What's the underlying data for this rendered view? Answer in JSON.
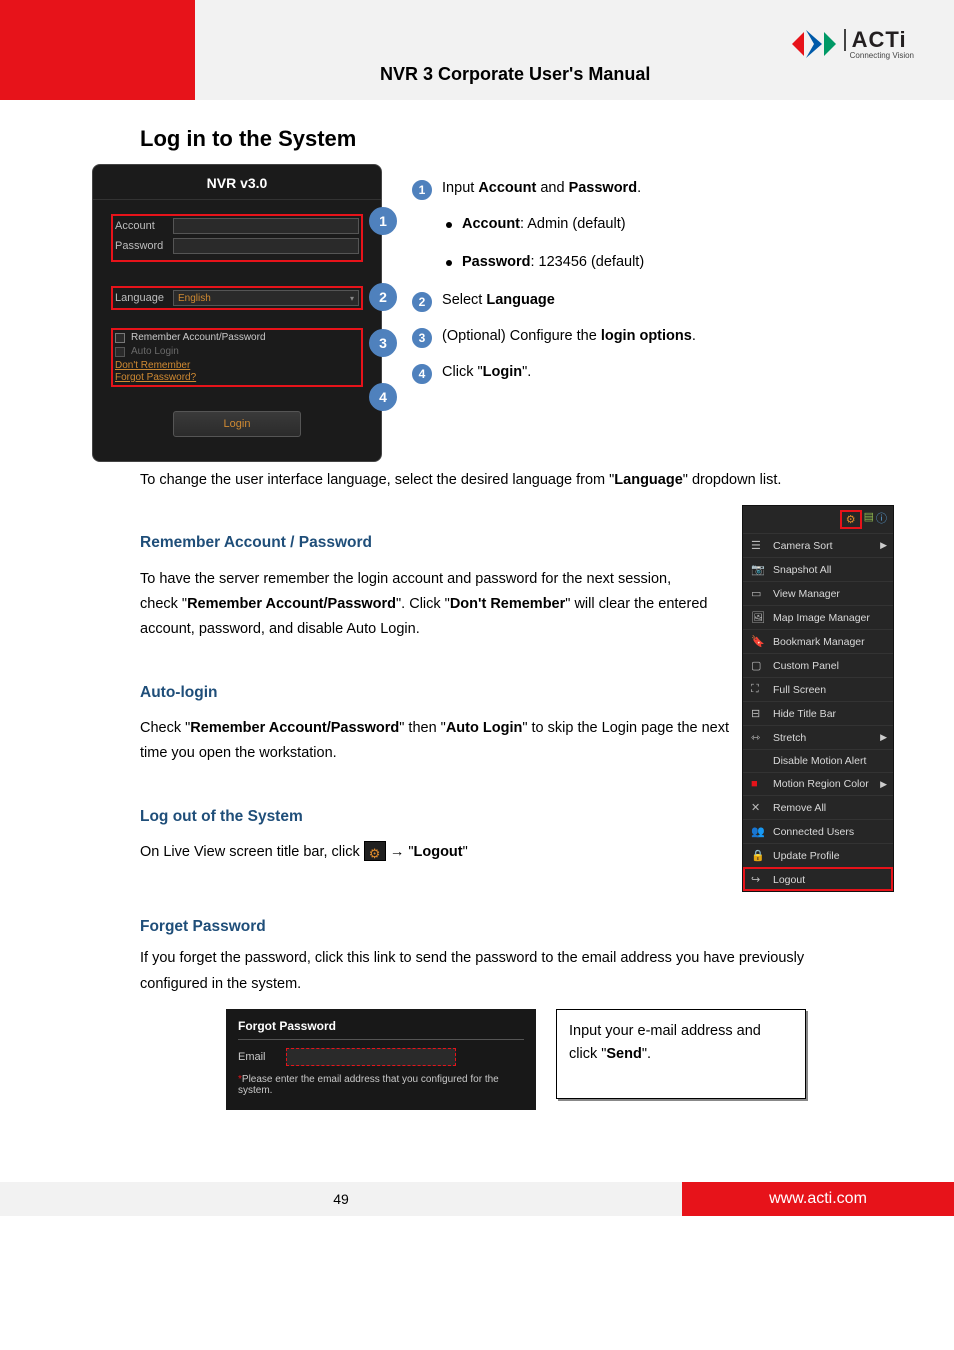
{
  "header": {
    "title": "NVR 3 Corporate User's Manual",
    "brand": "ACTi",
    "tagline": "Connecting Vision"
  },
  "section": {
    "title": "Log in to the System"
  },
  "login": {
    "title": "NVR v3.0",
    "account": "Account",
    "password": "Password",
    "language": "Language",
    "language_value": "English",
    "remember": "Remember Account/Password",
    "auto": "Auto Login",
    "dont": "Don't Remember",
    "forgot": "Forgot Password?",
    "button": "Login"
  },
  "circles": {
    "c1": "1",
    "c2": "2",
    "c3": "3",
    "c4": "4"
  },
  "steps": {
    "s1": {
      "n": "1",
      "text_a": "Input ",
      "text_b": "Account",
      "text_c": " and ",
      "text_d": "Password",
      "text_e": "."
    },
    "bullet1a": " Account",
    "bullet1b": ": Admin (default)",
    "bullet2a": " Password",
    "bullet2b": ": 123456 (default)",
    "s2_a": "Select ",
    "s2_b": "Language",
    "s2_n": "2",
    "s3_a": "(Optional) Configure the ",
    "s3_b": "login options",
    "s3_c": ".",
    "s3_n": "3",
    "s4_a": "Click \"",
    "s4_b": "Login",
    "s4_c": "\".",
    "s4_n": "4"
  },
  "lang_para": {
    "a": "To change the user interface language, select the desired language from \"",
    "b": "Language",
    "c": "\" dropdown list."
  },
  "rem": {
    "title": "Remember Account / Password",
    "a": "To have the server remember the login account and password for the next session,",
    "b": "check \"",
    "c": "Remember Account/Password",
    "d": "\". Click \"",
    "e": "Don't Remember",
    "f": "\" will clear the entered account, password, and disable Auto Login."
  },
  "auto": {
    "title": "Auto-login",
    "a": "Check \"",
    "b": "Remember Account/Password",
    "c": "\" then \"",
    "d": "Auto Login",
    "e": "\" to skip the Login page the next time you open the workstation."
  },
  "logout": {
    "title": "Log out of the System",
    "a": "On Live View screen title bar, click ",
    "b": " → \"",
    "c": "Logout",
    "d": "\""
  },
  "menu": {
    "items": [
      "Camera Sort",
      "Snapshot All",
      "View Manager",
      "Map Image Manager",
      "Bookmark Manager",
      "Custom Panel",
      "Full Screen",
      "Hide Title Bar",
      "Stretch",
      "Disable Motion Alert",
      "Motion Region Color",
      "Remove All",
      "Connected Users",
      "Update Profile",
      "Logout"
    ],
    "icons": [
      "sort",
      "snap",
      "view",
      "map",
      "book",
      "custom",
      "full",
      "hide",
      "stretch",
      "none",
      "motion",
      "remove",
      "users",
      "update",
      "logout"
    ]
  },
  "forgot_pw": {
    "title": "Forget Password",
    "panel_title": "Forgot Password",
    "para": "If you forget the password, click this link to send the password to the email address you have previously configured in the system.",
    "email": "Email",
    "note_ast": "*",
    "note": "Please enter the email address that you configured for the system."
  },
  "note_box": {
    "a": "Input your e-mail address and click \"",
    "b": "Send",
    "c": "\"."
  },
  "footer": {
    "page": "49",
    "url": "www.acti.com"
  }
}
